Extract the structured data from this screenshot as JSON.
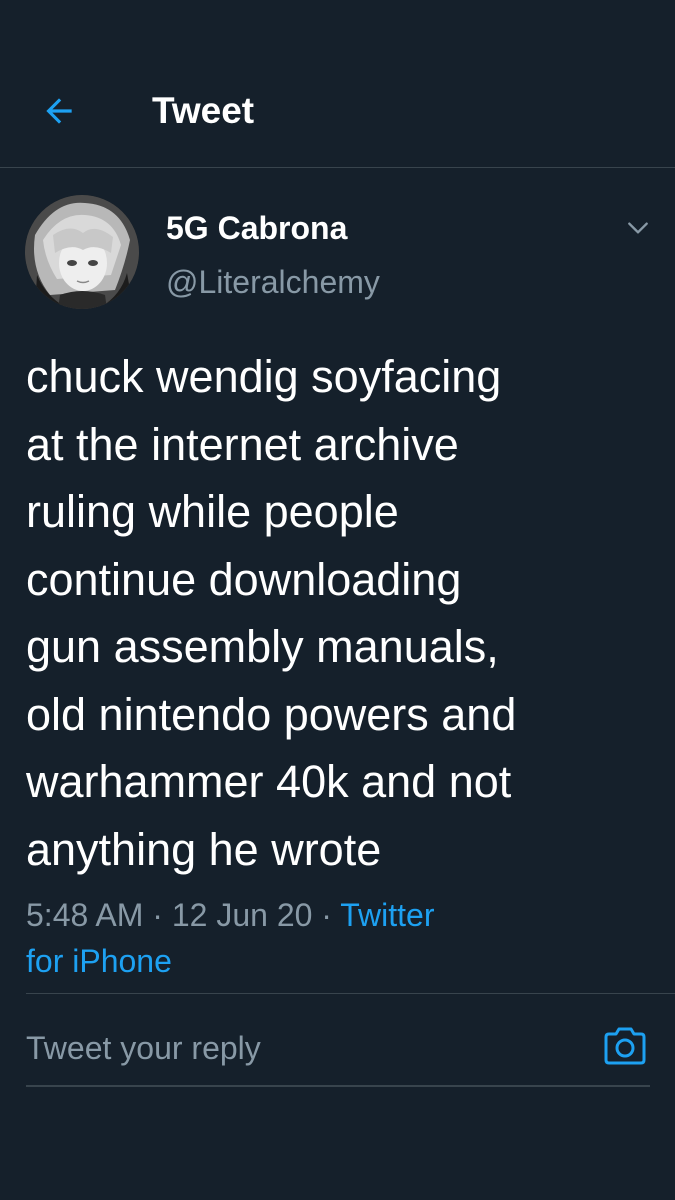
{
  "header": {
    "title": "Tweet",
    "back_icon": "arrow-left-icon"
  },
  "tweet": {
    "author": {
      "display_name": "5G Cabrona",
      "handle": "@Literalchemy"
    },
    "text": "chuck wendig soyfacing\nat the internet archive\nruling while people\ncontinue downloading\ngun assembly manuals,\nold nintendo powers and\nwarhammer 40k and not\nanything he wrote",
    "time": "5:48 AM",
    "date": "12 Jun 20",
    "separator": " · ",
    "source_part1": "Twitter",
    "source_part2": "for iPhone",
    "caret_icon": "chevron-down-icon"
  },
  "reply": {
    "placeholder": "Tweet your reply",
    "camera_icon": "camera-icon"
  },
  "colors": {
    "background": "#15202b",
    "accent": "#1da1f2",
    "secondary_text": "#8899a6",
    "divider": "#38444d"
  }
}
